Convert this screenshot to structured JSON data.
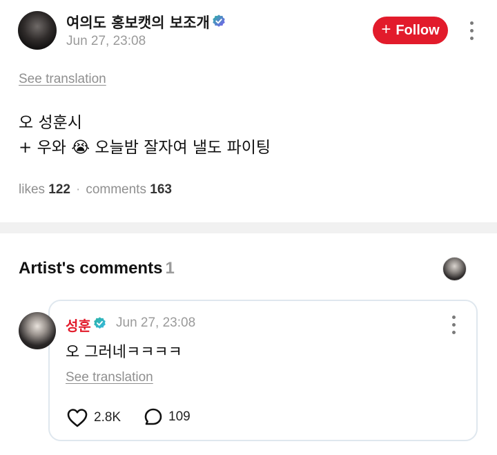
{
  "post": {
    "author": "여의도 홍보캣의 보조개",
    "time": "Jun 27, 23:08",
    "follow_label": "Follow",
    "see_translation": "See translation",
    "body_lines": [
      "오 성훈시",
      "+ 우와 😭 오늘밤 잘자여 낼도 파이팅"
    ],
    "likes_label": "likes",
    "likes_count": "122",
    "comments_label": "comments",
    "comments_count": "163"
  },
  "artist_comments": {
    "title": "Artist's comments",
    "count": "1",
    "comment": {
      "author": "성훈",
      "time": "Jun 27, 23:08",
      "text": "오 그러네ㅋㅋㅋㅋ",
      "see_translation": "See translation",
      "likes": "2.8K",
      "replies": "109"
    }
  },
  "colors": {
    "accent_red": "#e21b2b",
    "badge_purple": "#7b5cf0",
    "badge_teal": "#2bb3a3",
    "muted_text": "#8f8f8f"
  },
  "icons": [
    "verified-badge-icon",
    "plus-icon",
    "more-vertical-icon",
    "heart-icon",
    "comment-bubble-icon"
  ]
}
